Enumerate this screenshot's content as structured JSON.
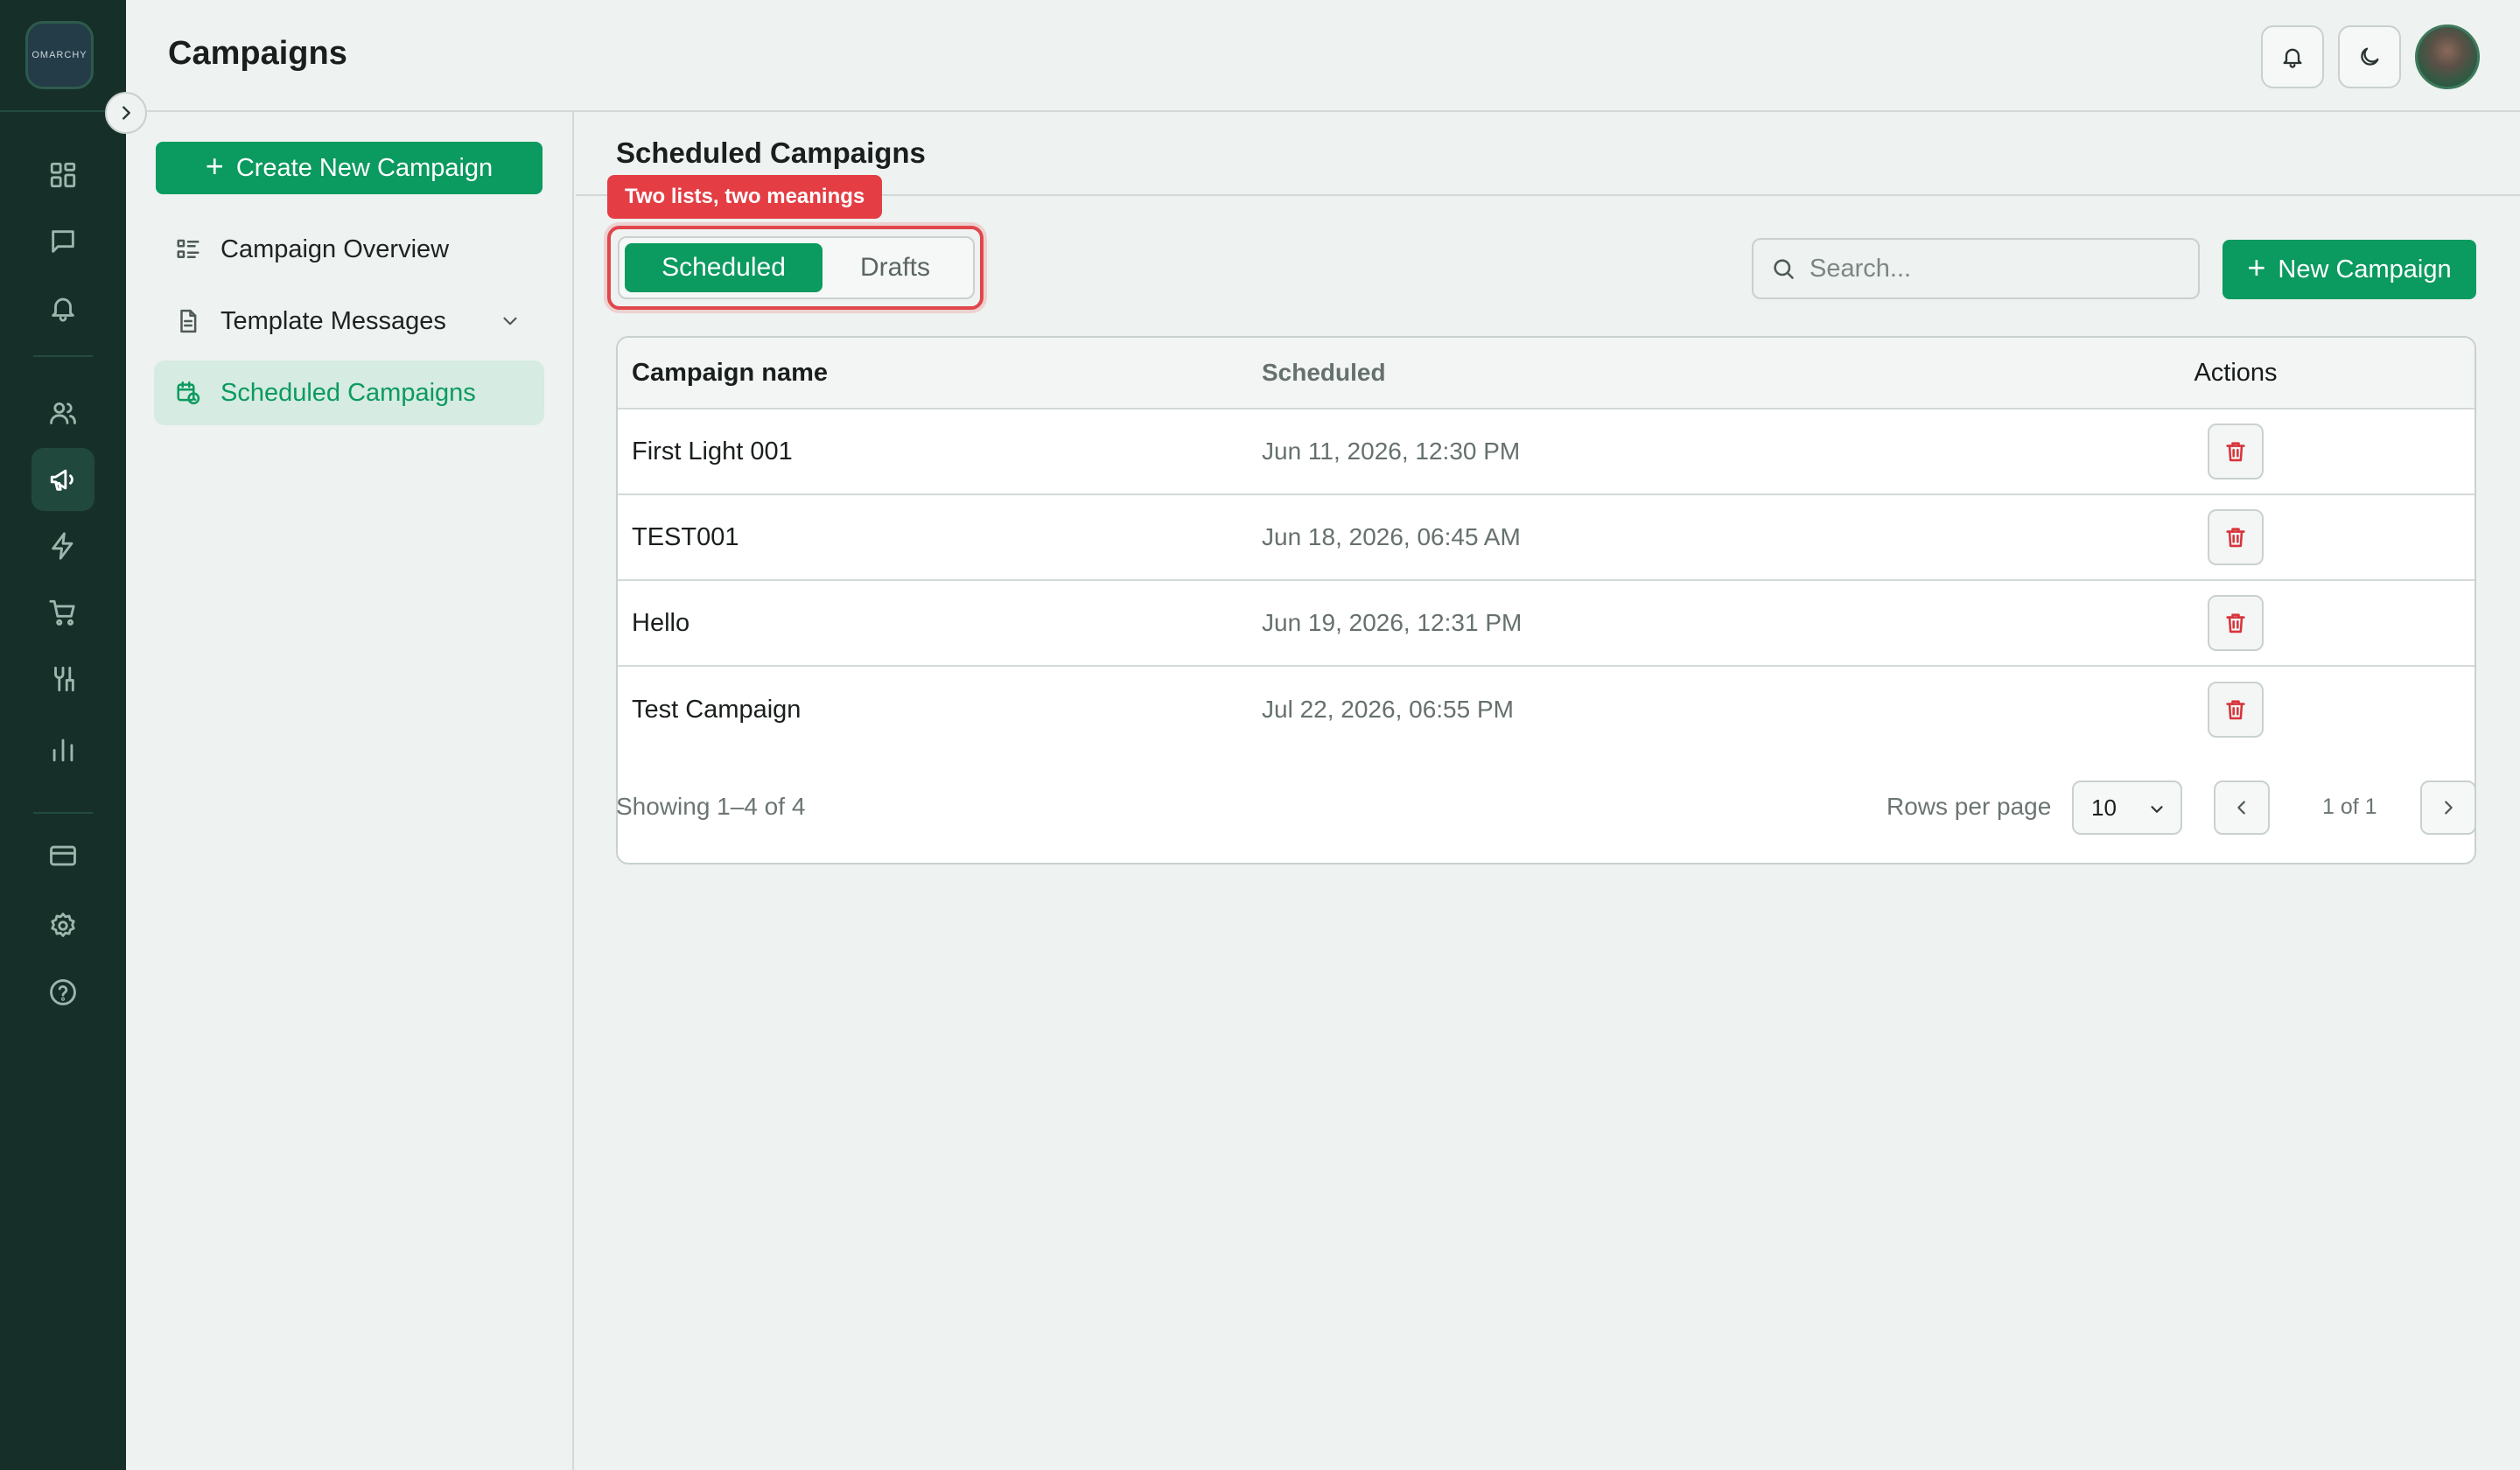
{
  "app": {
    "logo_text": "OMARCHY"
  },
  "header": {
    "title": "Campaigns"
  },
  "rail": {
    "items": [
      {
        "icon": "dashboard-icon"
      },
      {
        "icon": "chat-icon"
      },
      {
        "icon": "bell-icon"
      },
      {
        "icon": "contacts-icon"
      },
      {
        "icon": "megaphone-icon",
        "active": true
      },
      {
        "icon": "lightning-icon"
      },
      {
        "icon": "cart-icon"
      },
      {
        "icon": "integrations-icon"
      },
      {
        "icon": "analytics-icon"
      },
      {
        "icon": "billing-icon"
      },
      {
        "icon": "settings-icon"
      },
      {
        "icon": "help-icon"
      }
    ]
  },
  "subnav": {
    "create_label": "Create New Campaign",
    "items": [
      {
        "label": "Campaign Overview"
      },
      {
        "label": "Template Messages"
      },
      {
        "label": "Scheduled Campaigns",
        "active": true
      }
    ]
  },
  "main": {
    "title": "Scheduled Campaigns",
    "callout": "Two lists, two meanings",
    "tabs": [
      {
        "label": "Scheduled",
        "selected": true
      },
      {
        "label": "Drafts",
        "selected": false
      }
    ],
    "search": {
      "placeholder": "Search..."
    },
    "new_campaign_label": "New Campaign",
    "table": {
      "columns": [
        "Campaign name",
        "Scheduled",
        "Actions"
      ],
      "rows": [
        {
          "name": "First Light 001",
          "scheduled": "Jun 11, 2026, 12:30 PM"
        },
        {
          "name": "TEST001",
          "scheduled": "Jun 18, 2026, 06:45 AM"
        },
        {
          "name": "Hello",
          "scheduled": "Jun 19, 2026, 12:31 PM"
        },
        {
          "name": "Test Campaign",
          "scheduled": "Jul 22, 2026, 06:55 PM"
        }
      ]
    },
    "pagination": {
      "showing": "Showing 1–4 of 4",
      "rows_label": "Rows per page",
      "rows_value": "10",
      "page_text": "1 of 1"
    }
  },
  "colors": {
    "accent": "#0b9a5f",
    "rail": "#163029",
    "callout": "#e43d44",
    "danger": "#d7353c"
  }
}
